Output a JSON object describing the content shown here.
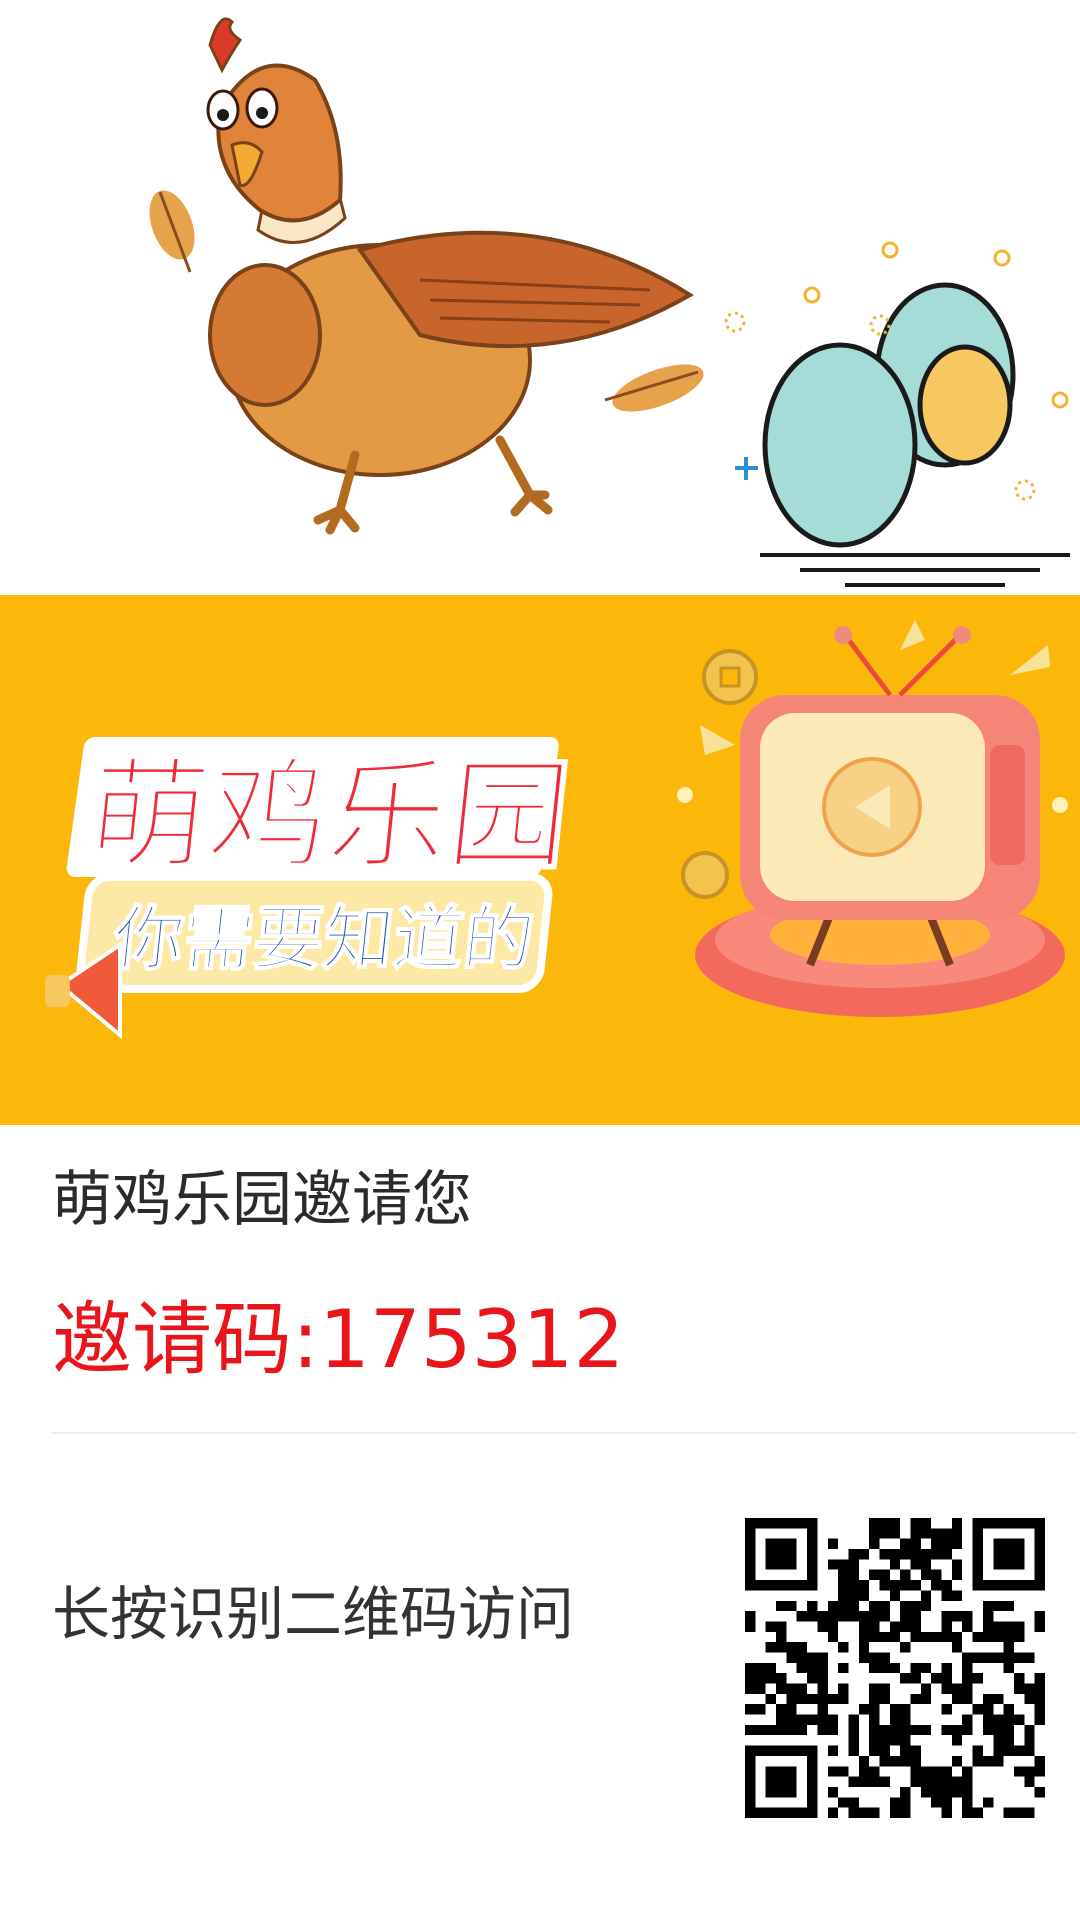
{
  "banner": {
    "title": "萌鸡乐园",
    "subtitle": "你需要知道的"
  },
  "invite": {
    "title": "萌鸡乐园邀请您",
    "code_text": "邀请码:175312",
    "code_color": "#e8151b"
  },
  "qr": {
    "hint": "长按识别二维码访问"
  },
  "colors": {
    "banner_bg": "#fbb80b",
    "title_red": "#ef2b39",
    "subtitle_blue": "#1d4fb5"
  }
}
